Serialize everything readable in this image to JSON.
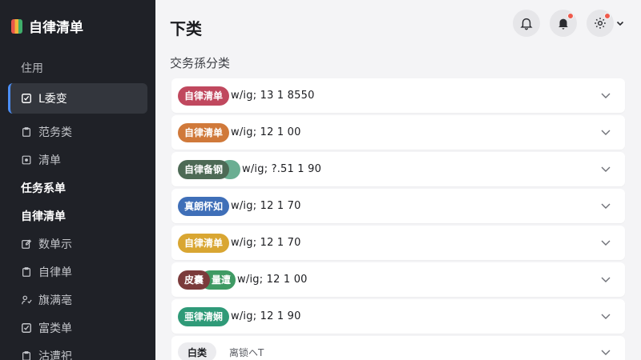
{
  "app": {
    "title": "自律清单"
  },
  "sidebar": {
    "section_label": "住用",
    "items": [
      {
        "label": "L委变",
        "icon": "checkbox-icon",
        "active": true
      },
      {
        "label": "范务类",
        "icon": "clipboard-icon"
      },
      {
        "label": "清单",
        "icon": "square-dot-icon"
      },
      {
        "label": "任务系单",
        "bold": true
      },
      {
        "label": "自律清单",
        "bold": true
      },
      {
        "label": "数单示",
        "icon": "edit-icon"
      },
      {
        "label": "自律单",
        "icon": "clipboard-icon"
      },
      {
        "label": "旗满亳",
        "icon": "people-icon"
      },
      {
        "label": "富类单",
        "icon": "checkbox-icon"
      },
      {
        "label": "沽遭祀",
        "icon": "clipboard-icon"
      }
    ]
  },
  "header": {
    "title": "下类",
    "subtitle": "交务孫分类",
    "icons": [
      "bell-icon",
      "bell-alert-icon",
      "gear-icon"
    ]
  },
  "rows": [
    {
      "tag": "自律清单",
      "tag_color": "#c0485e",
      "text": "w/ig; 13 1 8550"
    },
    {
      "tag": "自律清单",
      "tag_color": "#d0793a",
      "text": "w/ig; 12 1 00"
    },
    {
      "tag": "自律备钢",
      "tag_color": "#4d6a55",
      "tag2": "",
      "tag2_color": "#6aae92",
      "text": "w/ig; ?.51 1 90"
    },
    {
      "tag": "真朗怀如",
      "tag_color": "#3f6fb8",
      "text": "w/ig; 12 1 70"
    },
    {
      "tag": "自律清单",
      "tag_color": "#d9a632",
      "text": "w/ig; 12 1 70"
    },
    {
      "tag": "皮囊",
      "tag_color": "#7b3b3b",
      "tag2": "量遭",
      "tag2_color": "#3f9a64",
      "text": "w/ig; 12 1 00"
    },
    {
      "tag": "亜律清娴",
      "tag_color": "#2f9a78",
      "text": "w/ig; 12 1 90"
    }
  ],
  "last_row": {
    "tag": "白类",
    "text": "离锁ヘT"
  }
}
